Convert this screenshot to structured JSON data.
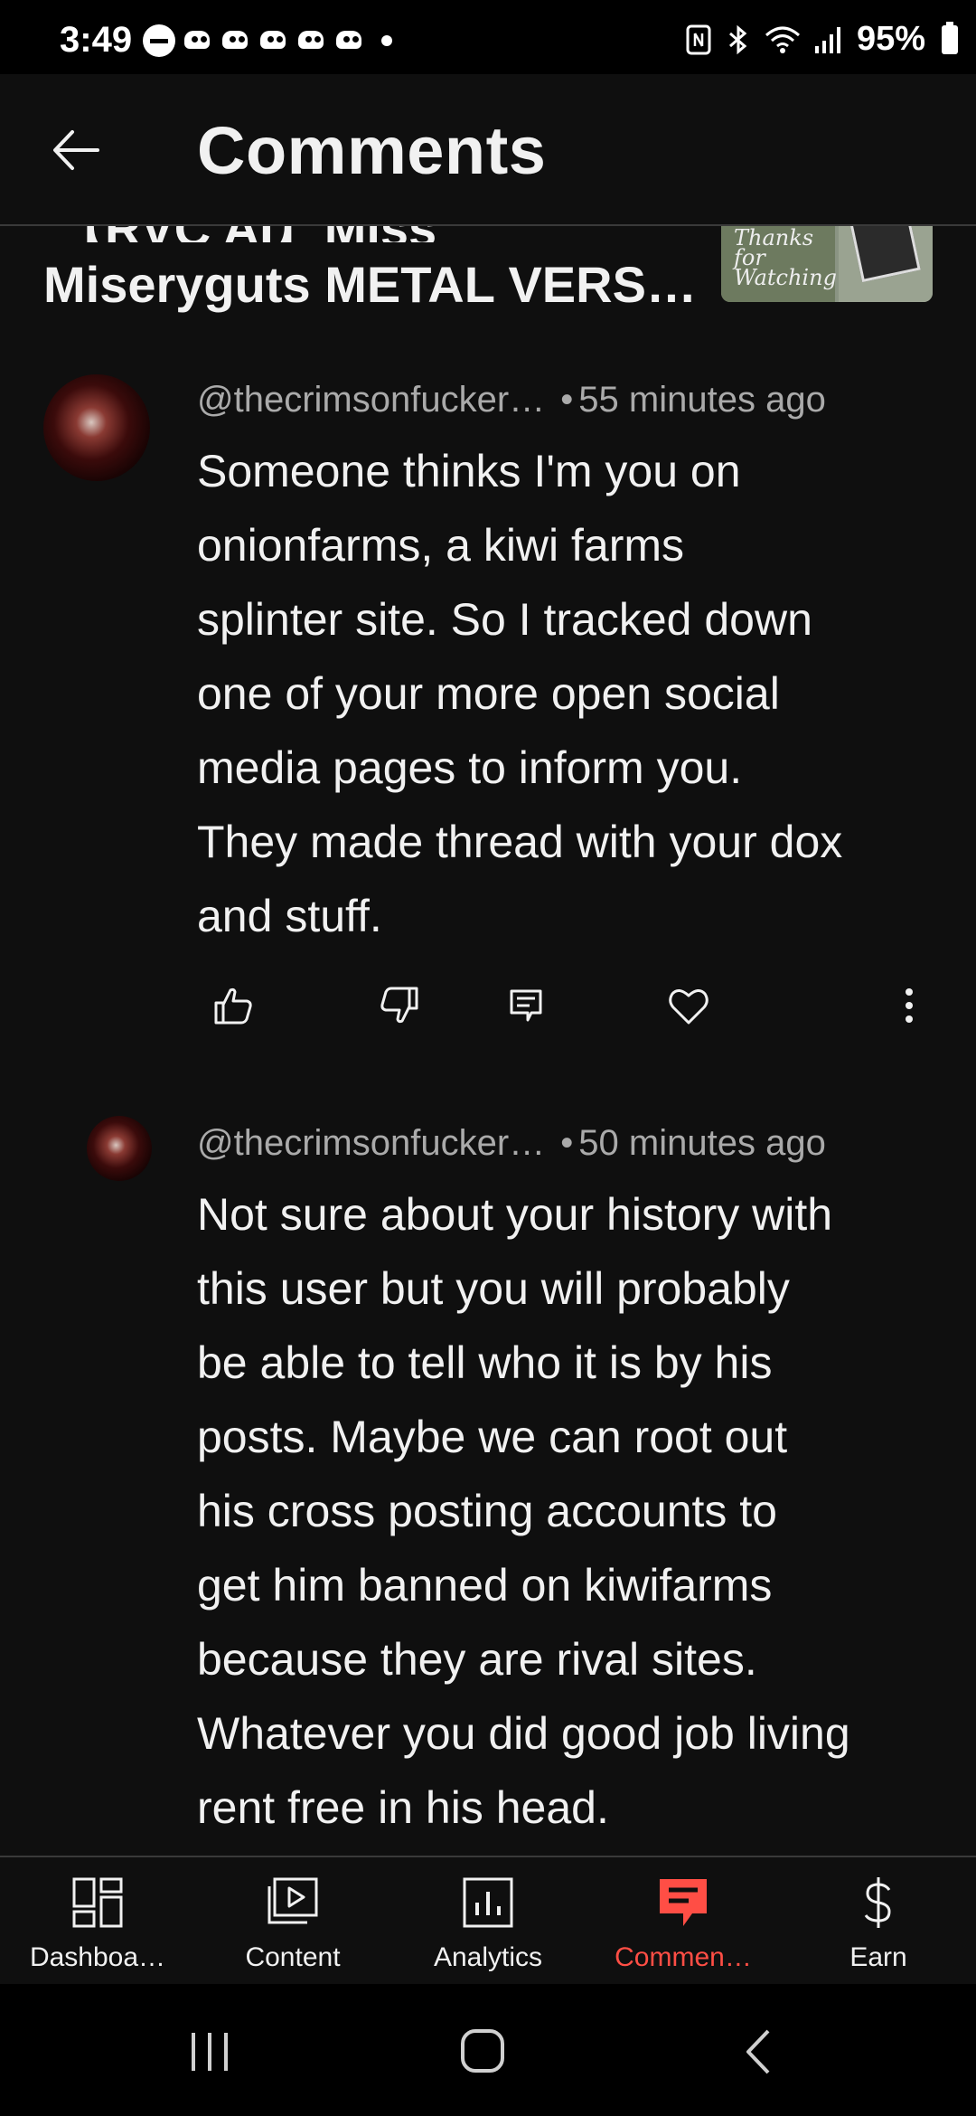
{
  "status_bar": {
    "time": "3:49",
    "battery": "95%",
    "notification_icons": [
      "do-not-disturb-icon",
      "notification-icon",
      "notification-icon",
      "notification-icon",
      "notification-icon",
      "notification-icon",
      "more-dot-icon"
    ],
    "right_icons": [
      "nfc-icon",
      "bluetooth-icon",
      "wifi-icon",
      "signal-icon",
      "battery-icon"
    ]
  },
  "header": {
    "title": "Comments",
    "back_icon": "arrow-left-icon"
  },
  "video": {
    "title_top_partial": "【RVC AI】Miss",
    "title": "Miseryguts METAL VERS…",
    "thumb_text_line1": "Thanks for",
    "thumb_text_line2": "Watching"
  },
  "comments": [
    {
      "author": "@thecrimsonfucker…",
      "time": "55 minutes ago",
      "text_lines": [
        "Someone thinks I'm you on",
        "onionfarms, a kiwi farms",
        "splinter site. So I tracked down",
        "one of your more open social",
        "media pages to inform you.",
        "They made thread with your dox",
        "and stuff."
      ]
    },
    {
      "author": "@thecrimsonfucker…",
      "time": "50 minutes ago",
      "text_lines": [
        "Not sure about your history with",
        "this user but you will probably",
        "be able to tell who it is by his",
        "posts. Maybe we can root out",
        "his cross posting accounts to",
        "get him banned on kiwifarms",
        "because they are rival sites.",
        "Whatever you did good job living",
        "rent free in his head."
      ]
    }
  ],
  "bottom_nav": [
    {
      "label": "Dashboa…",
      "icon": "dashboard-icon",
      "active": false
    },
    {
      "label": "Content",
      "icon": "content-icon",
      "active": false
    },
    {
      "label": "Analytics",
      "icon": "analytics-icon",
      "active": false
    },
    {
      "label": "Commen…",
      "icon": "comments-icon",
      "active": true
    },
    {
      "label": "Earn",
      "icon": "dollar-icon",
      "active": false
    }
  ],
  "colors": {
    "accent": "#ff4e45",
    "background": "#0f0f0f",
    "secondary_text": "#aaaaaa"
  }
}
